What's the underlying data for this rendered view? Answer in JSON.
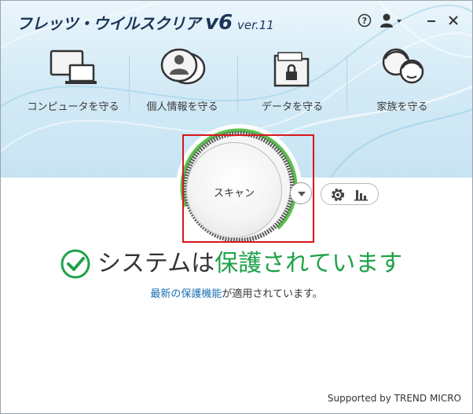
{
  "app": {
    "brand_jp": "フレッツ・ウイルスクリア",
    "brand_version": "v6",
    "brand_ver_small": "ver.11"
  },
  "window_controls": {
    "help_icon": "question-circle-icon",
    "user_icon": "user-dropdown-icon",
    "minimize_icon": "minimize-icon",
    "close_icon": "close-icon"
  },
  "nav": [
    {
      "label": "コンピュータを守る",
      "icon": "computer-monitor-icon"
    },
    {
      "label": "個人情報を守る",
      "icon": "personal-info-bubble-icon"
    },
    {
      "label": "データを守る",
      "icon": "locked-folder-icon"
    },
    {
      "label": "家族を守る",
      "icon": "family-faces-icon"
    }
  ],
  "scan": {
    "label": "スキャン",
    "dropdown_icon": "chevron-down-icon"
  },
  "tools": {
    "settings_icon": "gear-icon",
    "reports_icon": "bar-chart-icon"
  },
  "status": {
    "icon": "check-circle-icon",
    "text_prefix": "システムは",
    "text_highlight": "保護されています",
    "sub_link": "最新の保護機能",
    "sub_text": "が適用されています。"
  },
  "footer": {
    "supported": "Supported by TREND MICRO"
  },
  "colors": {
    "accent_green": "#1fa14a",
    "ring_green": "#5bbf4e",
    "link_blue": "#1a6fb3",
    "brand_navy": "#1d3557",
    "highlight_red": "#d7161c"
  }
}
